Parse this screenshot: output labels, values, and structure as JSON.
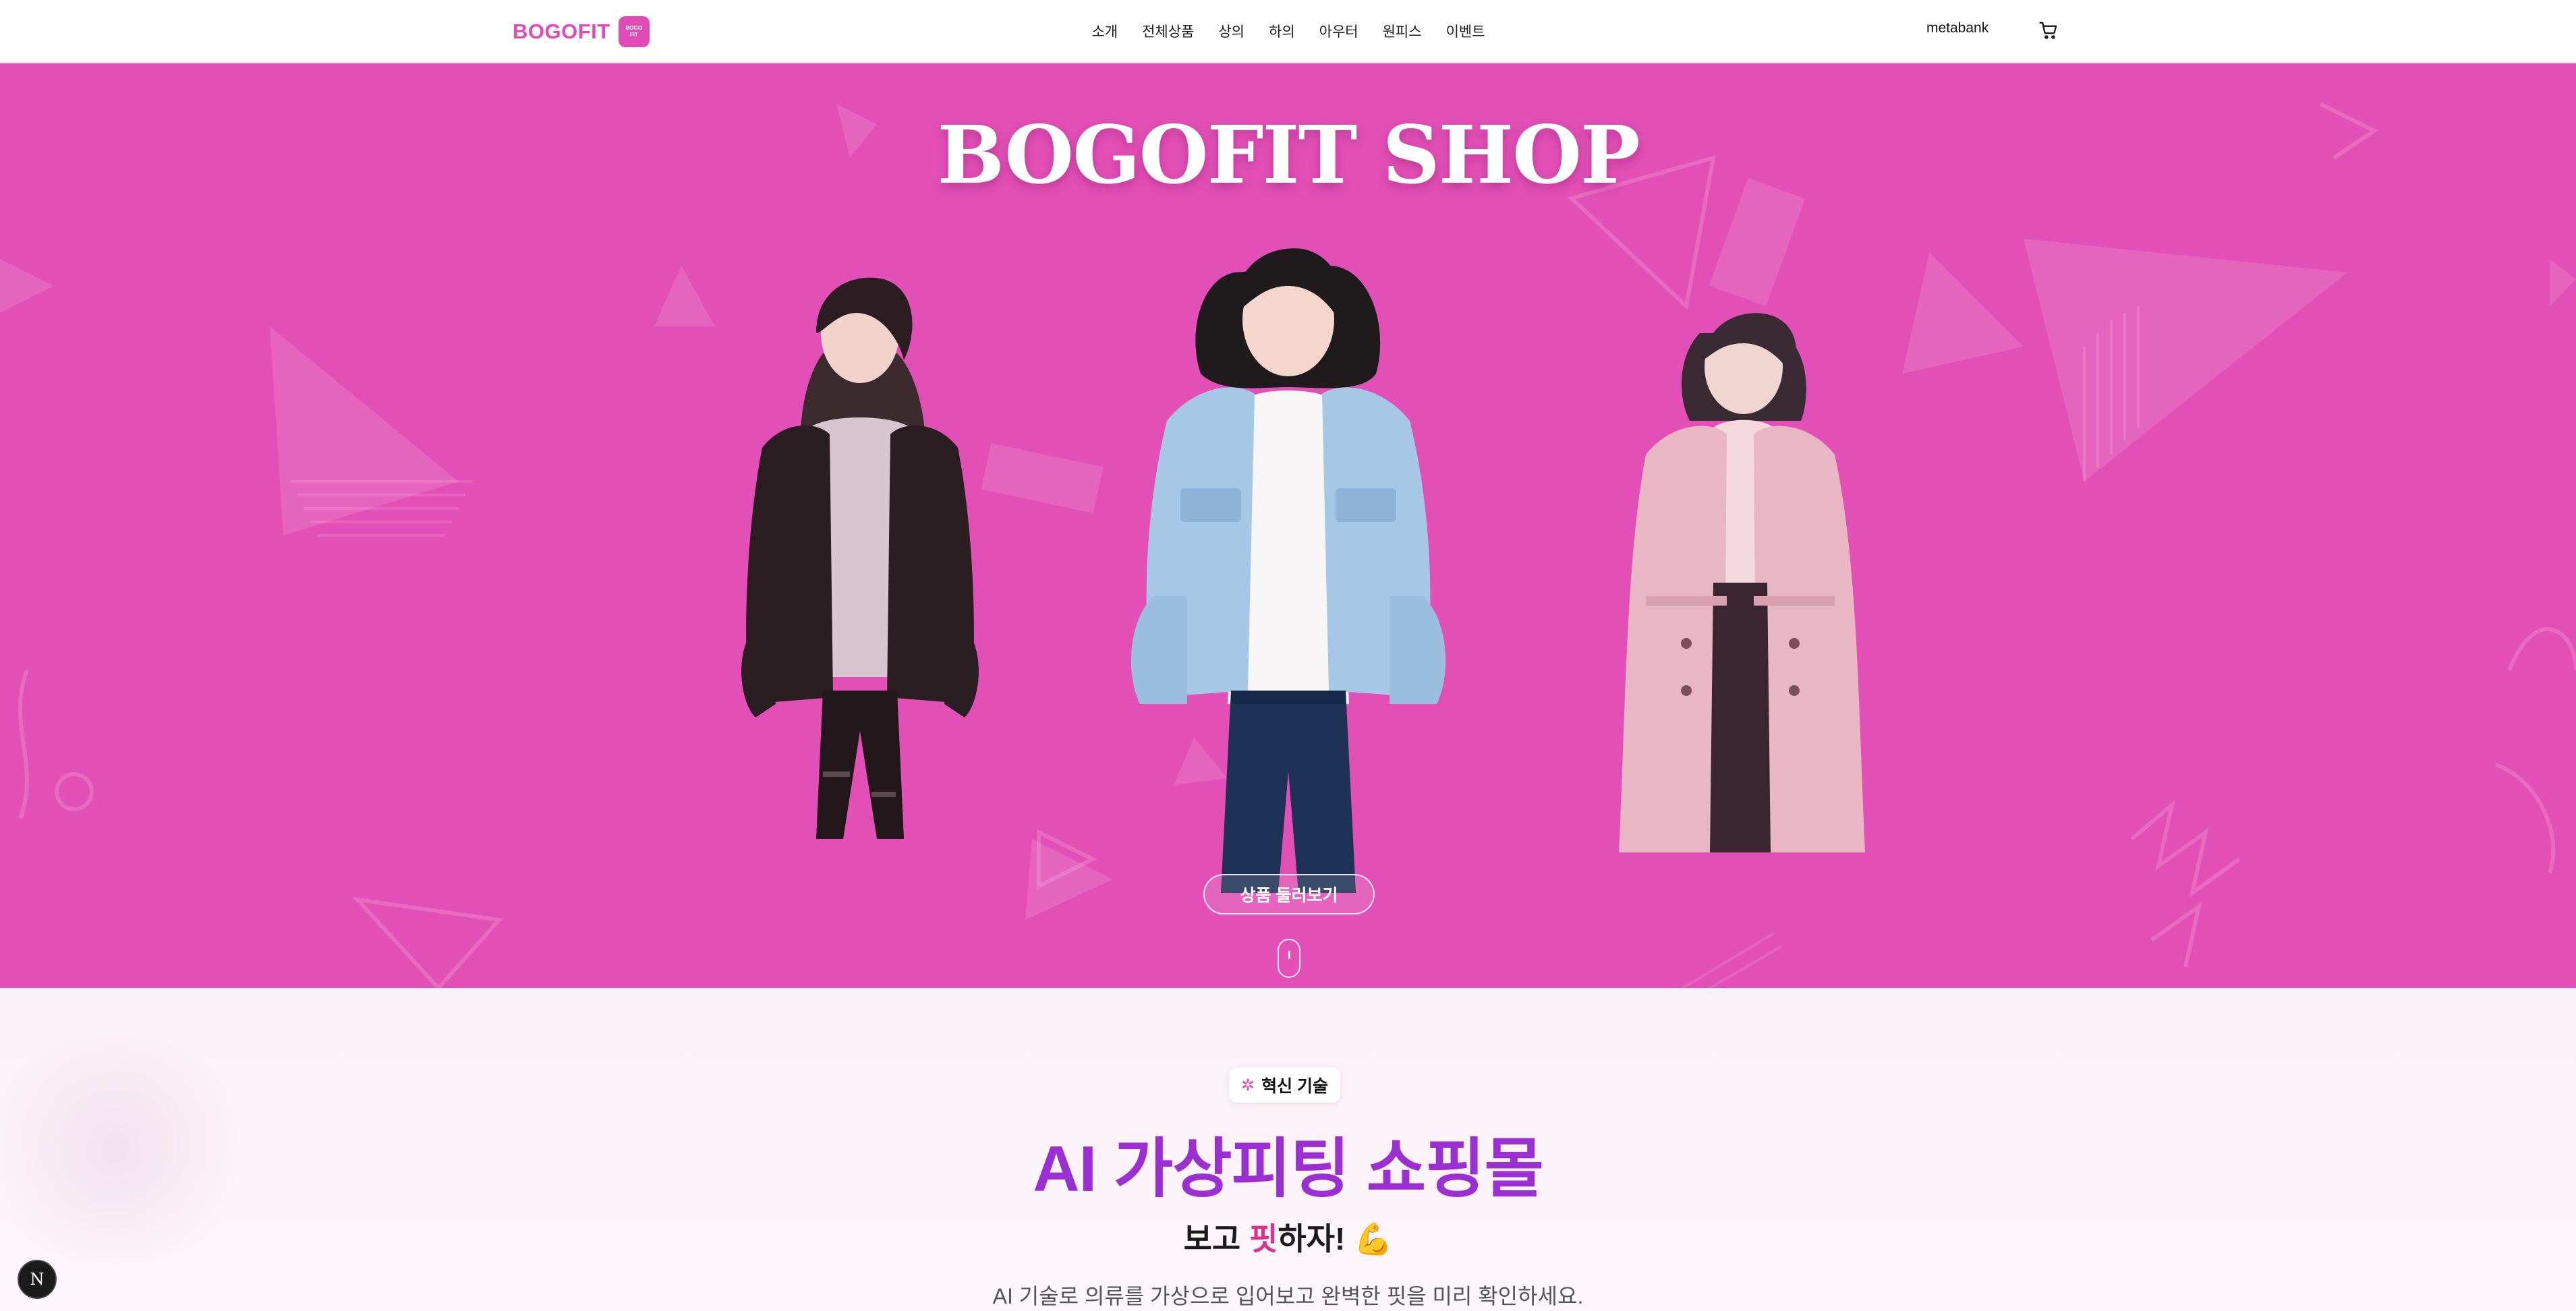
{
  "nav": {
    "brand": "BOGOFIT",
    "brand_badge_top": "BOGO",
    "brand_badge_bottom": "FIT",
    "menu": [
      "소개",
      "전체상품",
      "상의",
      "하의",
      "아우터",
      "원피스",
      "이벤트"
    ],
    "user": "metabank",
    "cart_icon": "cart-icon"
  },
  "hero": {
    "title": "BOGOFIT SHOP",
    "browse_label": "상품 둘러보기",
    "background_color": "#e24fb6",
    "models": [
      "leather-jacket-model",
      "denim-jacket-model",
      "pink-coat-model"
    ]
  },
  "feature": {
    "tag": "혁신 기술",
    "title": "AI 가상피팅 쇼핑몰",
    "sub_pre": "보고 ",
    "sub_accent": "핏",
    "sub_post": "하자!",
    "sub_emoji": "💪",
    "description": "AI 기술로 의류를 가상으로 입어보고 완벽한 핏을 미리 확인하세요."
  },
  "dev_badge": "N",
  "colors": {
    "brand": "#e04bb6",
    "title_purple": "#9c2fd1",
    "accent_pink": "#e0308e"
  }
}
